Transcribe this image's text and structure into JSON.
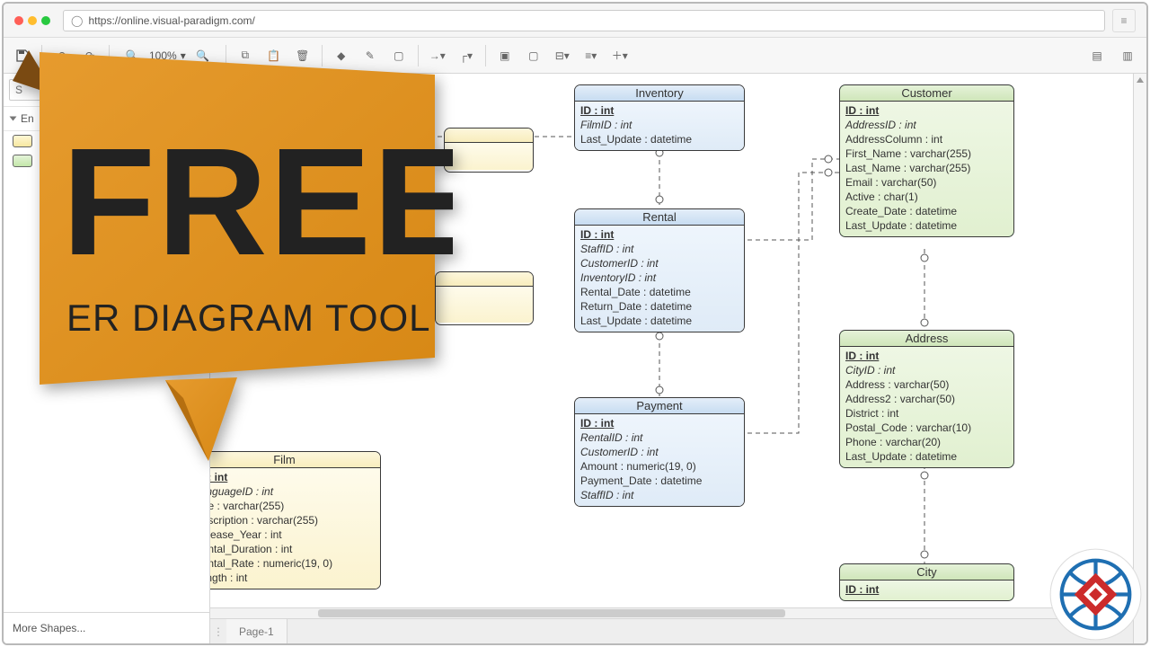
{
  "browser": {
    "url": "https://online.visual-paradigm.com/"
  },
  "toolbar": {
    "zoom_label": "100%"
  },
  "sidebar": {
    "search_placeholder": "Search Shapes",
    "search_value": "S",
    "category_label": "Entity Relationship",
    "category_short": "En",
    "more_shapes": "More Shapes..."
  },
  "banner": {
    "headline": "FREE",
    "subline": "ER DIAGRAM TOOL"
  },
  "page_tabs": {
    "tab1": "Page-1"
  },
  "entities": {
    "inventory": {
      "name": "Inventory",
      "rows": [
        {
          "label": "ID : int",
          "cls": "pk"
        },
        {
          "label": "FilmID : int",
          "cls": "fk"
        },
        {
          "label": "Last_Update : datetime",
          "cls": ""
        }
      ]
    },
    "customer": {
      "name": "Customer",
      "rows": [
        {
          "label": "ID : int",
          "cls": "pk"
        },
        {
          "label": "AddressID : int",
          "cls": "fk"
        },
        {
          "label": "AddressColumn : int",
          "cls": ""
        },
        {
          "label": "First_Name : varchar(255)",
          "cls": ""
        },
        {
          "label": "Last_Name : varchar(255)",
          "cls": ""
        },
        {
          "label": "Email : varchar(50)",
          "cls": ""
        },
        {
          "label": "Active : char(1)",
          "cls": ""
        },
        {
          "label": "Create_Date : datetime",
          "cls": ""
        },
        {
          "label": "Last_Update : datetime",
          "cls": ""
        }
      ]
    },
    "rental": {
      "name": "Rental",
      "rows": [
        {
          "label": "ID : int",
          "cls": "pk"
        },
        {
          "label": "StaffID : int",
          "cls": "fk"
        },
        {
          "label": "CustomerID : int",
          "cls": "fk"
        },
        {
          "label": "InventoryID : int",
          "cls": "fk"
        },
        {
          "label": "Rental_Date : datetime",
          "cls": ""
        },
        {
          "label": "Return_Date : datetime",
          "cls": ""
        },
        {
          "label": "Last_Update : datetime",
          "cls": ""
        }
      ]
    },
    "address": {
      "name": "Address",
      "rows": [
        {
          "label": "ID : int",
          "cls": "pk"
        },
        {
          "label": "CityID : int",
          "cls": "fk"
        },
        {
          "label": "Address : varchar(50)",
          "cls": ""
        },
        {
          "label": "Address2 : varchar(50)",
          "cls": ""
        },
        {
          "label": "District : int",
          "cls": ""
        },
        {
          "label": "Postal_Code : varchar(10)",
          "cls": ""
        },
        {
          "label": "Phone : varchar(20)",
          "cls": ""
        },
        {
          "label": "Last_Update : datetime",
          "cls": ""
        }
      ]
    },
    "payment": {
      "name": "Payment",
      "rows": [
        {
          "label": "ID : int",
          "cls": "pk"
        },
        {
          "label": "RentalID : int",
          "cls": "fk"
        },
        {
          "label": "CustomerID : int",
          "cls": "fk"
        },
        {
          "label": "Amount : numeric(19, 0)",
          "cls": ""
        },
        {
          "label": "Payment_Date : datetime",
          "cls": ""
        },
        {
          "label": "StaffID : int",
          "cls": "fk"
        }
      ]
    },
    "film": {
      "name": "Film",
      "rows": [
        {
          "label": "ID : int",
          "cls": "pk"
        },
        {
          "label": "LanguageID : int",
          "cls": "fk"
        },
        {
          "label": "Title : varchar(255)",
          "cls": ""
        },
        {
          "label": "Description : varchar(255)",
          "cls": ""
        },
        {
          "label": "Release_Year : int",
          "cls": ""
        },
        {
          "label": "Rental_Duration : int",
          "cls": ""
        },
        {
          "label": "Rental_Rate : numeric(19, 0)",
          "cls": ""
        },
        {
          "label": "Length : int",
          "cls": ""
        }
      ]
    },
    "city": {
      "name": "City",
      "rows": [
        {
          "label": "ID : int",
          "cls": "pk"
        }
      ]
    }
  }
}
